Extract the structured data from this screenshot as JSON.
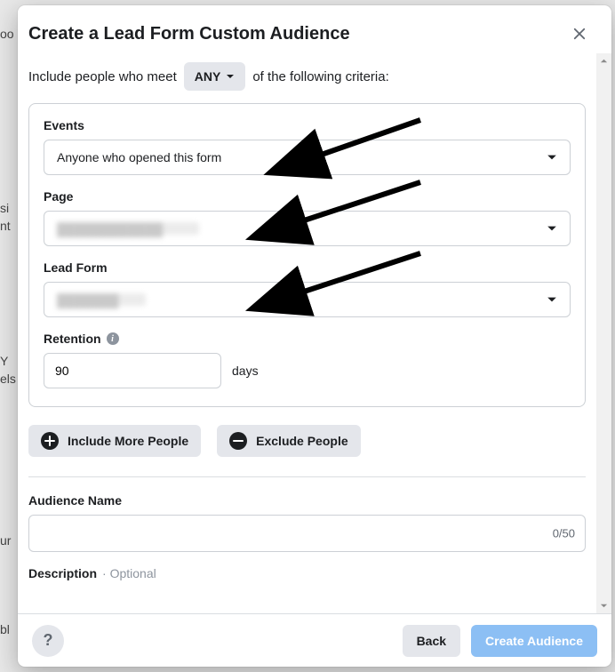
{
  "header": {
    "title": "Create a Lead Form Custom Audience"
  },
  "criteria": {
    "prefix": "Include people who meet",
    "mode": "ANY",
    "suffix": "of the following criteria:"
  },
  "events": {
    "label": "Events",
    "selected": "Anyone who opened this form"
  },
  "page": {
    "label": "Page",
    "selected": "████████████"
  },
  "lead_form": {
    "label": "Lead Form",
    "selected": "███████"
  },
  "retention": {
    "label": "Retention",
    "value": "90",
    "unit": "days"
  },
  "actions": {
    "include_label": "Include More People",
    "exclude_label": "Exclude People"
  },
  "audience_name": {
    "label": "Audience Name",
    "value": "",
    "counter": "0/50"
  },
  "description": {
    "label": "Description",
    "optional_tag": "· Optional"
  },
  "footer": {
    "help": "?",
    "back": "Back",
    "create": "Create Audience"
  }
}
